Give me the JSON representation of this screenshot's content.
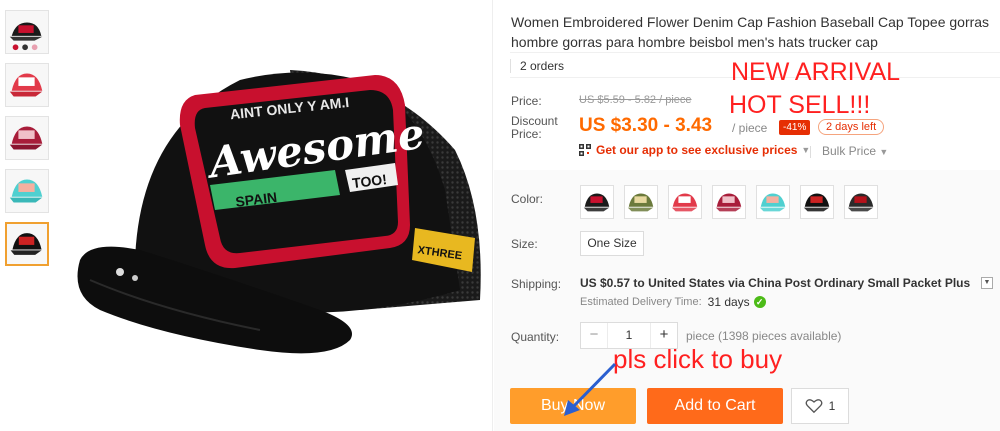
{
  "product": {
    "title": "Women Embroidered Flower Denim Cap Fashion Baseball Cap Topee gorras hombre gorras para hombre beisbol men's hats trucker cap",
    "orders": "2 orders",
    "cap_text": {
      "top_arc": "AINT ONLY Y AM.I",
      "brand_script": "Awesome",
      "green_band": "SPAIN",
      "tag": "TOO!",
      "side_patch": "XTHREE"
    }
  },
  "pricing": {
    "price_label": "Price:",
    "original": "US $5.59 - 5.82 / piece",
    "discount_label": "Discount Price:",
    "discounted": "US $3.30 - 3.43",
    "per_piece": "/ piece",
    "discount_pct": "-41%",
    "days_left": "2 days left",
    "app_promo": "Get our app to see exclusive prices",
    "bulk_price": "Bulk Price"
  },
  "color": {
    "label": "Color:",
    "swatches": [
      {
        "name": "swatch-1",
        "crown": "#1a1a1a",
        "patch": "#c8102e"
      },
      {
        "name": "swatch-2",
        "crown": "#6b7a3c",
        "patch": "#e8d9a0"
      },
      {
        "name": "swatch-3",
        "crown": "#e23a4a",
        "patch": "#ffffff"
      },
      {
        "name": "swatch-4",
        "crown": "#a81d3a",
        "patch": "#f0c0c8"
      },
      {
        "name": "swatch-5",
        "crown": "#4fd0d0",
        "patch": "#f5b0a0"
      },
      {
        "name": "swatch-6",
        "crown": "#111111",
        "patch": "#cc2222"
      },
      {
        "name": "swatch-7",
        "crown": "#2a2a2a",
        "patch": "#b5121b"
      }
    ]
  },
  "size": {
    "label": "Size:",
    "option": "One Size"
  },
  "shipping": {
    "label": "Shipping:",
    "cost": "US $0.57",
    "to": "to",
    "destination": "United States via China Post Ordinary Small Packet Plus",
    "est_label": "Estimated Delivery Time:",
    "est_days": "31 days"
  },
  "quantity": {
    "label": "Quantity:",
    "minus": "−",
    "value": "1",
    "plus": "+",
    "note": "piece (1398 pieces available)"
  },
  "actions": {
    "buy_now": "Buy Now",
    "add_to_cart": "Add to Cart",
    "wishlist_count": "1"
  },
  "overlay_text": {
    "new_arrival": "NEW ARRIVAL",
    "hot_sell": "HOT  SELL!!!",
    "pls_click": "pls click to buy"
  },
  "colors": {
    "accent_orange": "#ff6a00",
    "buy_button": "#ff9d2b",
    "cart_button": "#ff6a1a",
    "overlay_red": "#ff2020"
  },
  "thumbnails": [
    {
      "crown": "#1a1a1a",
      "patch": "#c8102e"
    },
    {
      "crown": "#e23a4a",
      "patch": "#ffffff"
    },
    {
      "crown": "#a81d3a",
      "patch": "#f0c0c8"
    },
    {
      "crown": "#4fd0d0",
      "patch": "#f5b0a0"
    },
    {
      "crown": "#111111",
      "patch": "#cc2222"
    }
  ]
}
